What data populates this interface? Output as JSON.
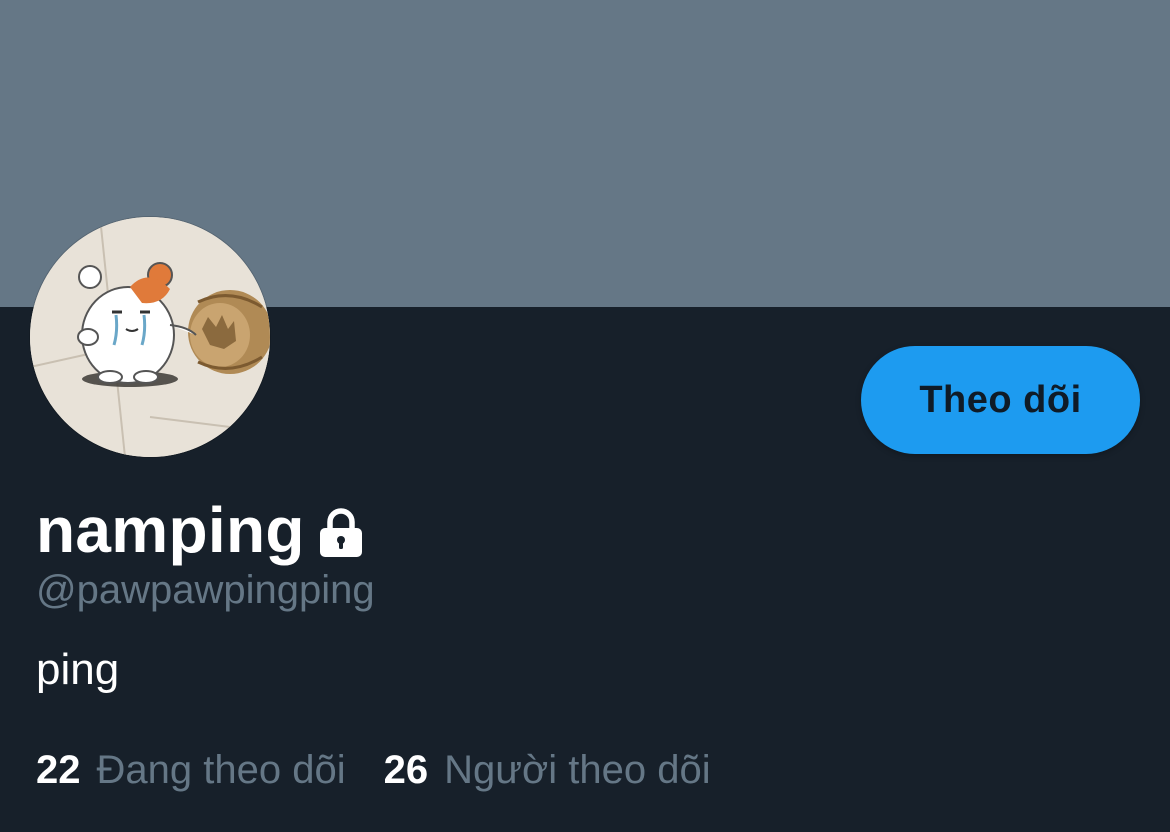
{
  "profile": {
    "display_name": "namping",
    "handle": "@pawpawpingping",
    "bio": "ping",
    "protected_icon": "lock-icon",
    "avatar_icon": "hamster-avatar"
  },
  "actions": {
    "follow_label": "Theo dõi"
  },
  "stats": {
    "following_count": "22",
    "following_label": "Đang theo dõi",
    "followers_count": "26",
    "followers_label": "Người theo dõi"
  },
  "colors": {
    "banner": "#657786",
    "background": "#17202a",
    "accent": "#1d9bf0",
    "secondary_text": "#657786"
  }
}
